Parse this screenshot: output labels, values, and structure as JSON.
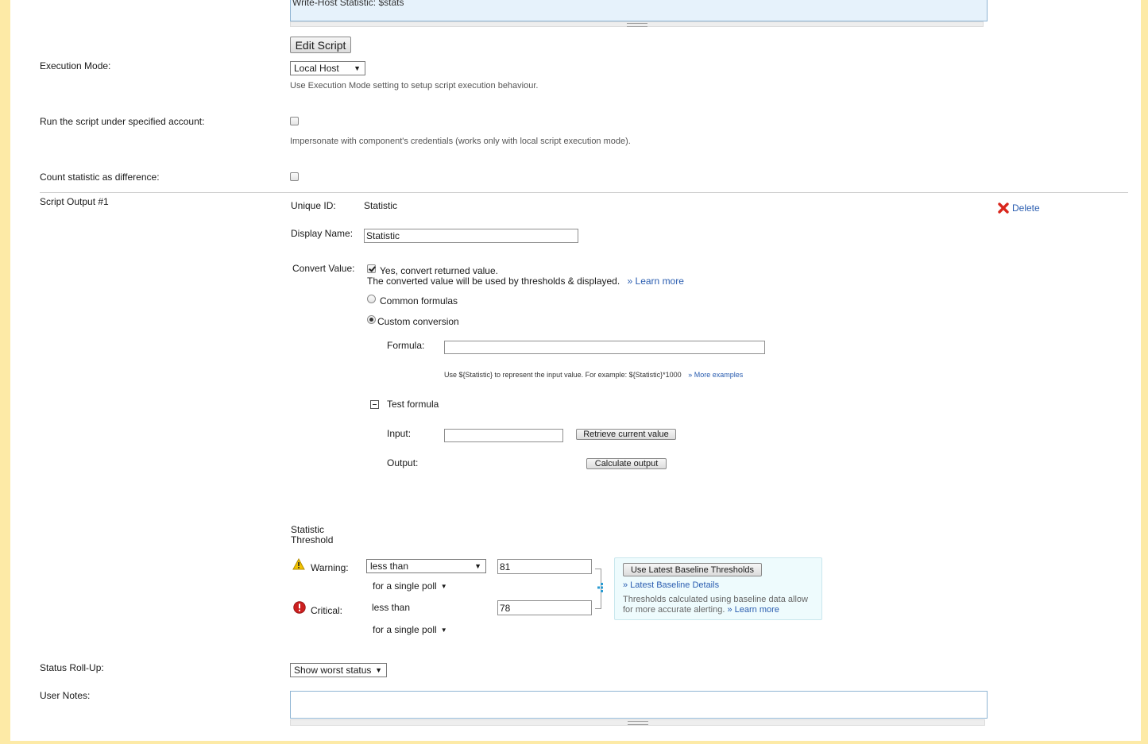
{
  "script": {
    "body_line": "Write-Host  Statistic: $stats",
    "edit_button": "Edit Script"
  },
  "execution_mode": {
    "label": "Execution Mode:",
    "value": "Local Host",
    "hint": "Use Execution Mode setting to setup script execution behaviour."
  },
  "run_as": {
    "label": "Run the script under specified account:",
    "checked": false,
    "hint": "Impersonate with component's credentials (works only with local script execution mode)."
  },
  "count_difference": {
    "label": "Count statistic as difference:",
    "checked": false
  },
  "script_output": {
    "section_label": "Script Output #1",
    "delete_label": "Delete",
    "unique_id_label": "Unique ID:",
    "unique_id_value": "Statistic",
    "display_name_label": "Display Name:",
    "display_name_value": "Statistic",
    "convert": {
      "label": "Convert Value:",
      "checkbox_label": "Yes, convert returned value.",
      "checked": true,
      "note": "The converted value will be used by thresholds & displayed.",
      "learn_more": "» Learn more",
      "common_formulas": "Common formulas",
      "custom_conversion": "Custom conversion",
      "selected": "custom",
      "formula_label": "Formula:",
      "formula_value": "",
      "formula_hint": "Use ${Statistic} to represent the input value. For example: ${Statistic}*1000",
      "more_examples": "» More examples",
      "test_formula_label": "Test formula",
      "collapse_symbol": "−",
      "input_label": "Input:",
      "input_value": "",
      "retrieve_button": "Retrieve current value",
      "output_label": "Output:",
      "calculate_button": "Calculate output"
    },
    "threshold": {
      "title_line1": "Statistic",
      "title_line2": "Threshold",
      "warning_label": "Warning:",
      "warning_operator": "less than",
      "warning_value": "81",
      "warning_poll": "for a single poll",
      "critical_label": "Critical:",
      "critical_operator": "less than",
      "critical_value": "78",
      "critical_poll": "for a single poll",
      "baseline_button": "Use Latest Baseline Thresholds",
      "baseline_details": "» Latest Baseline Details",
      "baseline_note_line1": "Thresholds calculated using baseline data allow",
      "baseline_note_line2": "for more accurate alerting.",
      "baseline_learn_more": "» Learn more"
    }
  },
  "status_rollup": {
    "label": "Status Roll-Up:",
    "value": "Show worst status"
  },
  "user_notes": {
    "label": "User Notes:",
    "value": ""
  },
  "colors": {
    "page_border": "#fdeaa6",
    "link": "#2a5db0",
    "script_box": "#e6f2fb",
    "baseline_box": "#eefbfd",
    "warning": "#f2c200",
    "critical": "#cc1f1f",
    "delete_x": "#d9261c"
  },
  "icons": {
    "warning": "warning-triangle-icon",
    "critical": "critical-exclamation-icon",
    "delete": "delete-x-icon",
    "dropdown": "caret-down-icon",
    "collapse": "minus-square-icon",
    "baseline_link": "link-connector-icon"
  }
}
